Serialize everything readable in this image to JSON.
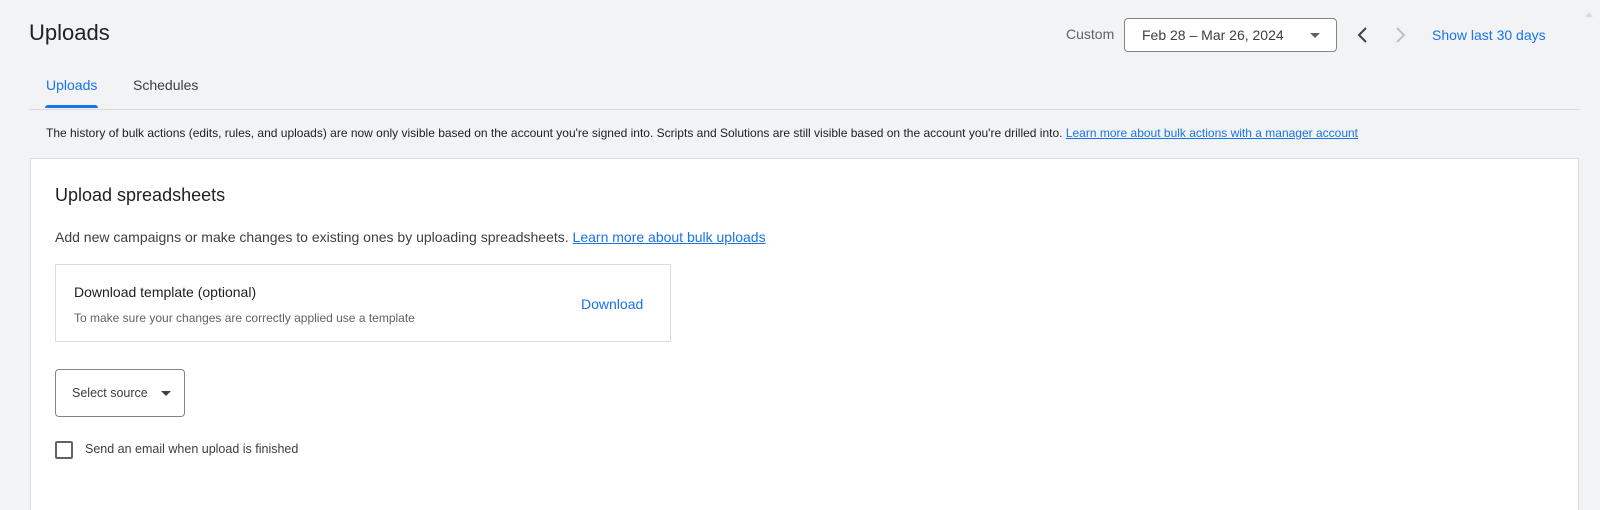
{
  "header": {
    "title": "Uploads",
    "range_label": "Custom",
    "date_range": "Feb 28 – Mar 26, 2024",
    "show_last": "Show last 30 days"
  },
  "tabs": [
    {
      "label": "Uploads",
      "active": true
    },
    {
      "label": "Schedules",
      "active": false
    }
  ],
  "notice": {
    "text": "The history of bulk actions (edits, rules, and uploads) are now only visible based on the account you're signed into. Scripts and Solutions are still visible based on the account you're drilled into. ",
    "link": "Learn more about bulk actions with a manager account"
  },
  "card": {
    "title": "Upload spreadsheets",
    "description": "Add new campaigns or make changes to existing ones by uploading spreadsheets. ",
    "description_link": "Learn more about bulk uploads",
    "template": {
      "title": "Download template (optional)",
      "subtitle": "To make sure your changes are correctly applied use a template",
      "action": "Download"
    },
    "source_select": "Select source",
    "email_checkbox": {
      "label": "Send an email when upload is finished",
      "checked": false
    }
  },
  "colors": {
    "accent": "#1a73e8",
    "background": "#f1f3f4",
    "card": "#ffffff"
  },
  "icons": [
    "chevron-left-icon",
    "chevron-right-icon",
    "dropdown-caret-icon"
  ]
}
